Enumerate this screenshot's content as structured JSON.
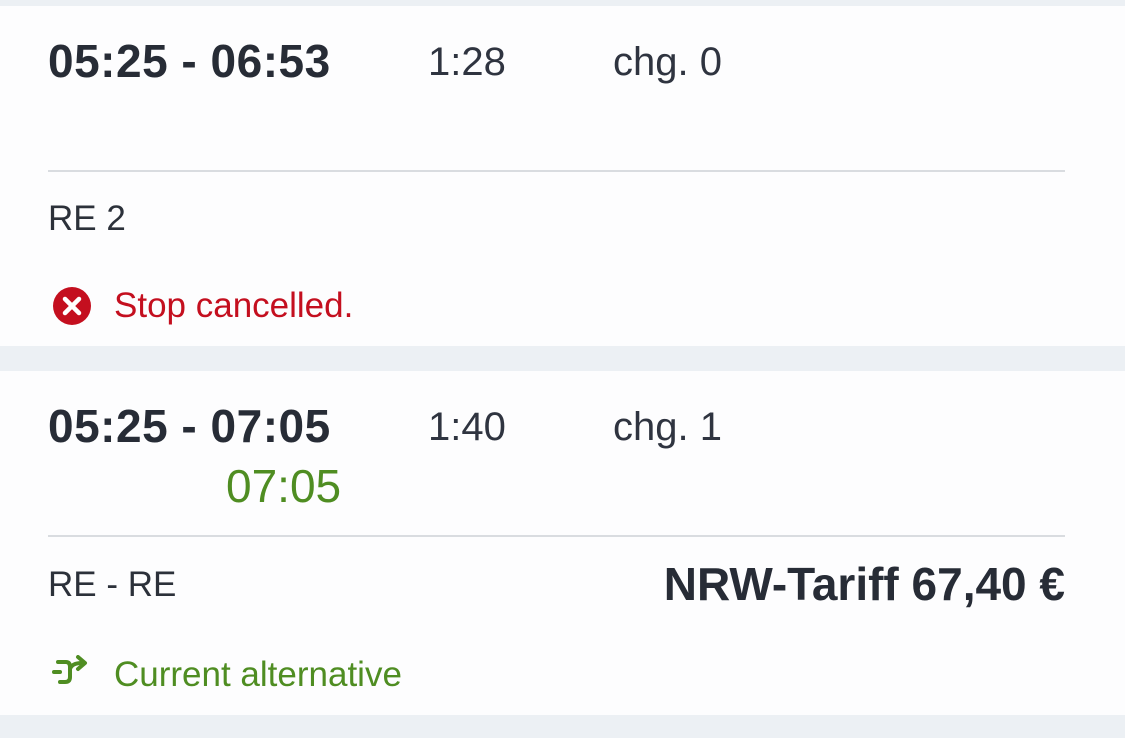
{
  "connections": [
    {
      "times": "05:25 - 06:53",
      "duration": "1:28",
      "changes": "chg. 0",
      "products": "RE 2",
      "message": "Stop cancelled.",
      "message_icon": "x-circle-icon",
      "colors": {
        "message": "#c40f1f"
      }
    },
    {
      "times": "05:25 - 07:05",
      "realtime_arrival": "07:05",
      "duration": "1:40",
      "changes": "chg. 1",
      "products": "RE - RE",
      "price": "NRW-Tariff 67,40 €",
      "message": "Current alternative",
      "message_icon": "alternative-route-arrow-icon",
      "colors": {
        "message": "#4f8d22",
        "realtime": "#4f8d22"
      }
    }
  ]
}
